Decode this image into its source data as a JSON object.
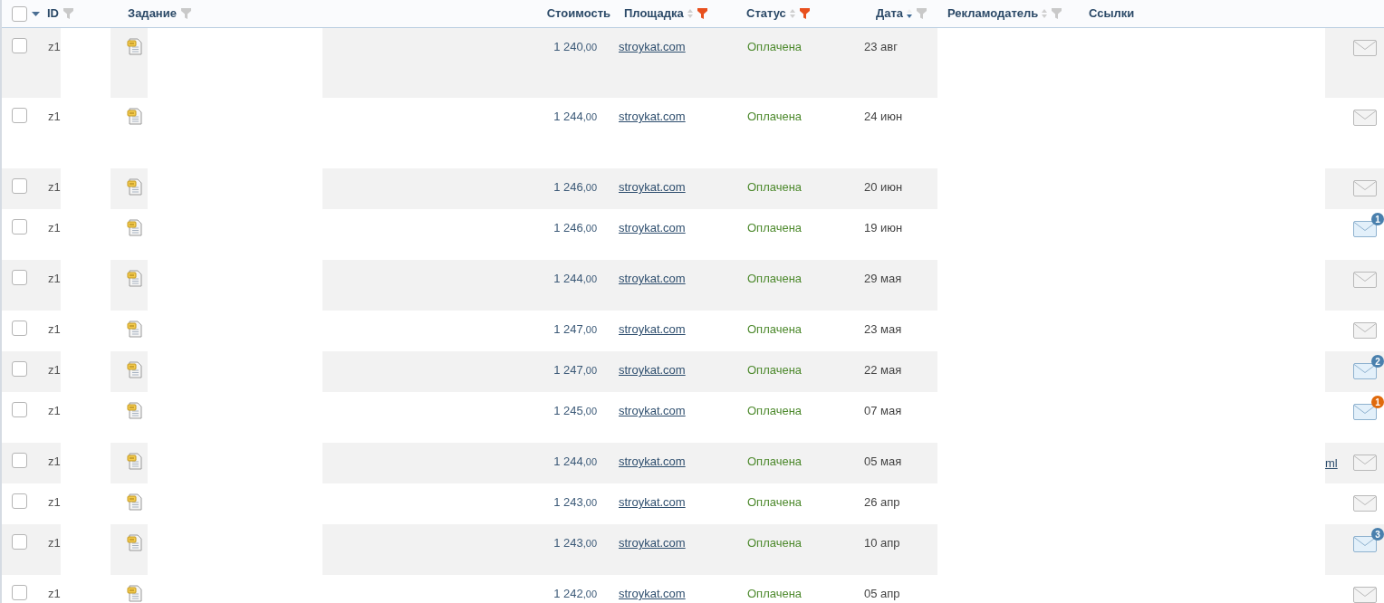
{
  "header": {
    "select_all": {
      "checked": false
    },
    "columns": [
      {
        "label": "ID",
        "filter_active": false
      },
      {
        "label": "Задание",
        "filter_active": false
      },
      {
        "label": "Стоимость"
      },
      {
        "label": "Площадка",
        "sorted": false,
        "filter_active": true
      },
      {
        "label": "Статус",
        "sorted": false,
        "filter_active": true
      },
      {
        "label": "Дата",
        "sorted": true,
        "filter_active": false
      },
      {
        "label": "Рекламодатель",
        "sorted": false,
        "filter_active": false
      },
      {
        "label": "Ссылки"
      }
    ]
  },
  "rows": [
    {
      "checked": false,
      "id": "z1",
      "cost": "1 240",
      "cents": ",00",
      "site": "stroykat.com",
      "status": "Оплачена",
      "date": "23 авг"
    },
    {
      "checked": false,
      "id": "z1",
      "cost": "1 244",
      "cents": ",00",
      "site": "stroykat.com",
      "status": "Оплачена",
      "date": "24 июн"
    },
    {
      "checked": false,
      "id": "z1",
      "cost": "1 246",
      "cents": ",00",
      "site": "stroykat.com",
      "status": "Оплачена",
      "date": "20 июн"
    },
    {
      "checked": false,
      "id": "z1",
      "cost": "1 246",
      "cents": ",00",
      "site": "stroykat.com",
      "status": "Оплачена",
      "date": "19 июн",
      "badge": {
        "text": "1",
        "color": "#4a80ad"
      }
    },
    {
      "checked": false,
      "id": "z1",
      "cost": "1 244",
      "cents": ",00",
      "site": "stroykat.com",
      "status": "Оплачена",
      "date": "29 мая"
    },
    {
      "checked": false,
      "id": "z1",
      "cost": "1 247",
      "cents": ",00",
      "site": "stroykat.com",
      "status": "Оплачена",
      "date": "23 мая"
    },
    {
      "checked": false,
      "id": "z1",
      "cost": "1 247",
      "cents": ",00",
      "site": "stroykat.com",
      "status": "Оплачена",
      "date": "22 мая",
      "badge": {
        "text": "2",
        "color": "#4a80ad"
      }
    },
    {
      "checked": false,
      "id": "z1",
      "cost": "1 245",
      "cents": ",00",
      "site": "stroykat.com",
      "status": "Оплачена",
      "date": "07 мая",
      "badge": {
        "text": "1",
        "color": "#e06a0c"
      }
    },
    {
      "checked": false,
      "id": "z1",
      "cost": "1 244",
      "cents": ",00",
      "site": "stroykat.com",
      "status": "Оплачена",
      "date": "05 мая",
      "link": "ml"
    },
    {
      "checked": false,
      "id": "z1",
      "cost": "1 243",
      "cents": ",00",
      "site": "stroykat.com",
      "status": "Оплачена",
      "date": "26 апр"
    },
    {
      "checked": false,
      "id": "z1",
      "cost": "1 243",
      "cents": ",00",
      "site": "stroykat.com",
      "status": "Оплачена",
      "date": "10 апр",
      "badge": {
        "text": "3",
        "color": "#4a80ad"
      }
    },
    {
      "checked": false,
      "id": "z1",
      "cost": "1 242",
      "cents": ",00",
      "site": "stroykat.com",
      "status": "Оплачена",
      "date": "05 апр"
    }
  ]
}
